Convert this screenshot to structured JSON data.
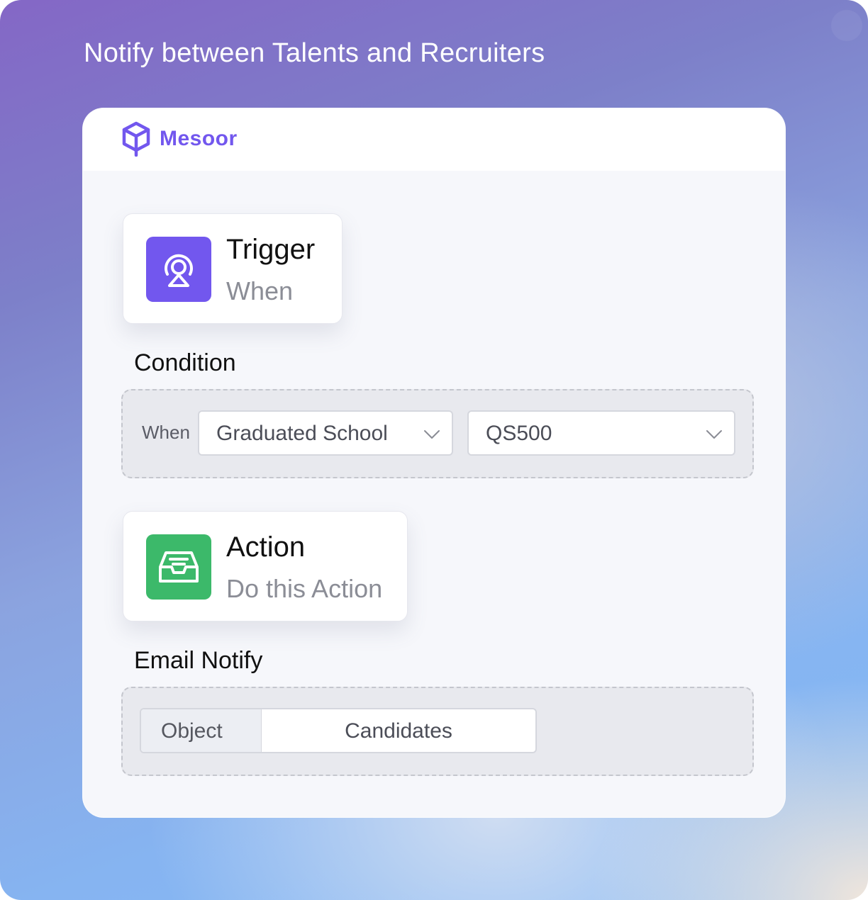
{
  "page": {
    "title": "Notify between Talents and Recruiters"
  },
  "brand": {
    "name": "Mesoor",
    "color": "#7257ee",
    "icon": "mesoor-logo-icon"
  },
  "trigger": {
    "title": "Trigger",
    "subtitle": "When",
    "icon": "broadcast-icon",
    "icon_color": "#7257ee"
  },
  "condition": {
    "label": "Condition",
    "when_label": "When",
    "field_select": {
      "value": "Graduated School"
    },
    "value_select": {
      "value": "QS500"
    }
  },
  "action": {
    "title": "Action",
    "subtitle": "Do this Action",
    "icon": "inbox-icon",
    "icon_color": "#3cb96a"
  },
  "email_notify": {
    "label": "Email Notify",
    "object_key": "Object",
    "object_value": "Candidates"
  }
}
